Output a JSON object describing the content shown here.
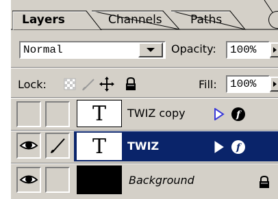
{
  "tabs": [
    {
      "label": "Layers",
      "active": true
    },
    {
      "label": "Channels",
      "active": false
    },
    {
      "label": "Paths",
      "active": false
    }
  ],
  "blend_mode": {
    "value": "Normal"
  },
  "opacity": {
    "label": "Opacity:",
    "value": "100%"
  },
  "lock": {
    "label": "Lock:",
    "icons": [
      "lock-transparent-icon",
      "lock-image-icon",
      "lock-position-icon",
      "lock-all-icon"
    ]
  },
  "fill": {
    "label": "Fill:",
    "value": "100%"
  },
  "layers": [
    {
      "name": "TWIZ copy",
      "type": "text",
      "visible": false,
      "selected": false,
      "thumbnail": "T"
    },
    {
      "name": "TWIZ",
      "type": "text",
      "visible": true,
      "selected": true,
      "thumbnail": "T"
    },
    {
      "name": "Background",
      "type": "image",
      "visible": true,
      "selected": false,
      "locked": true
    }
  ],
  "colors": {
    "panel": "#d4d0c8",
    "selection": "#0a246a",
    "arrow": "#3a3ad8"
  }
}
